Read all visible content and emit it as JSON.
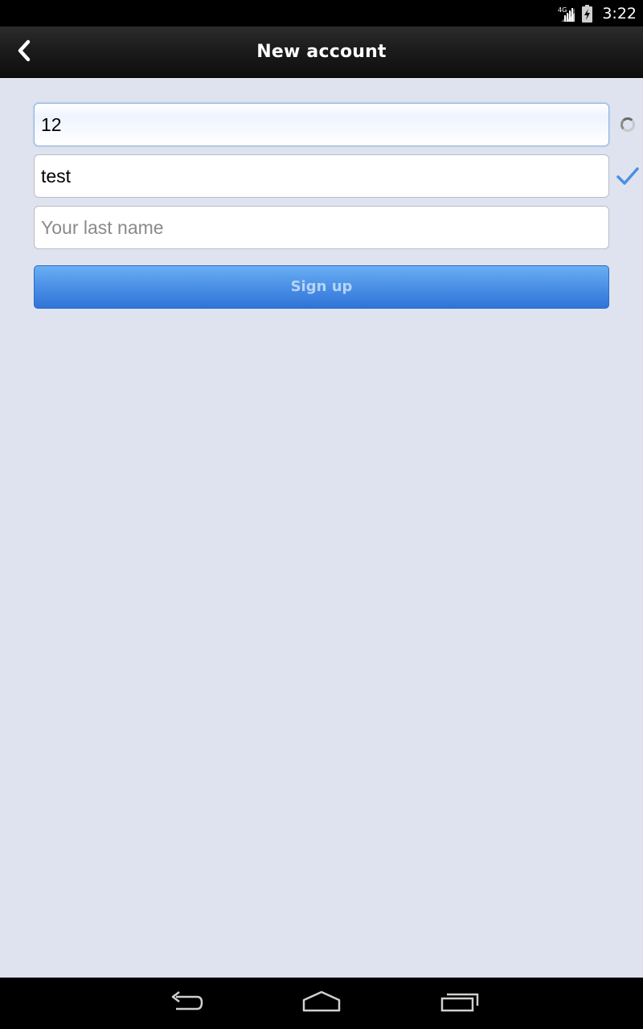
{
  "status_bar": {
    "network_label": "4G",
    "time": "3:22"
  },
  "action_bar": {
    "title": "New account",
    "back_icon": "chevron-left-icon"
  },
  "form": {
    "field1": {
      "value": "12",
      "status_icon": "loading-spinner-icon"
    },
    "field2": {
      "value": "test",
      "status_icon": "checkmark-icon"
    },
    "field3": {
      "value": "",
      "placeholder": "Your last name"
    },
    "signup_label": "Sign up"
  },
  "nav_bar": {
    "back_icon": "back-arrow-icon",
    "home_icon": "home-icon",
    "recents_icon": "recent-apps-icon"
  },
  "colors": {
    "background": "#dfe3ef",
    "accent": "#4a90e6",
    "check": "#4a90e2"
  }
}
